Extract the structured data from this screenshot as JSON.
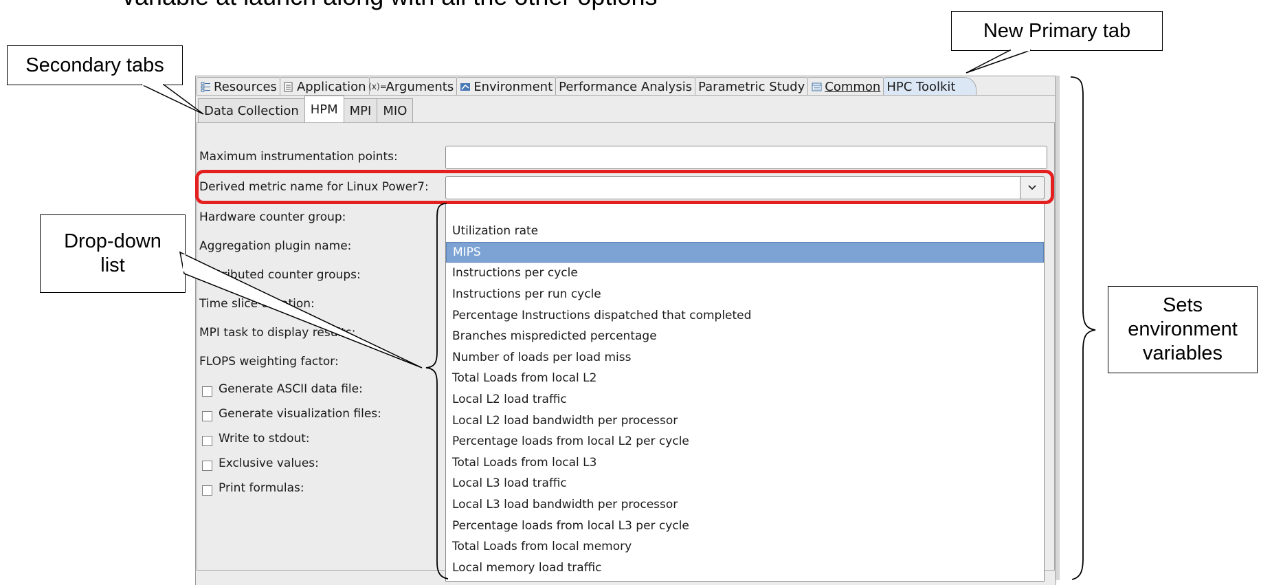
{
  "slide": {
    "heading_fragment": "variable at launch along with all the other options"
  },
  "callouts": {
    "secondary_tabs": "Secondary tabs",
    "new_primary_tab": "New Primary tab",
    "drop_down_line1": "Drop-down",
    "drop_down_line2": "list",
    "sets_line1": "Sets",
    "sets_line2": "environment",
    "sets_line3": "variables"
  },
  "primary_tabs": [
    {
      "label": "Resources",
      "icon": "resources-icon"
    },
    {
      "label": "Application",
      "icon": "document-icon"
    },
    {
      "label": "Arguments",
      "icon": "arguments-icon"
    },
    {
      "label": "Environment",
      "icon": "environment-icon"
    },
    {
      "label": "Performance Analysis",
      "icon": ""
    },
    {
      "label": "Parametric Study",
      "icon": ""
    },
    {
      "label": "Common",
      "icon": "common-icon"
    },
    {
      "label": "HPC Toolkit",
      "icon": "",
      "active": true
    }
  ],
  "secondary_tabs": [
    {
      "label": "Data Collection"
    },
    {
      "label": "HPM",
      "active": true
    },
    {
      "label": "MPI"
    },
    {
      "label": "MIO"
    }
  ],
  "form": {
    "max_points_label": "Maximum instrumentation points:",
    "max_points_value": "",
    "derived_metric_label": "Derived metric name for Linux Power7:",
    "derived_metric_value": "",
    "hw_counter_label": "Hardware counter group:",
    "aggregation_label": "Aggregation plugin name:",
    "distributed_label": "Distributed counter groups:",
    "time_slice_label": "Time slice duration:",
    "mpi_task_label": "MPI task to display results:",
    "flops_label": "FLOPS weighting factor:",
    "gen_ascii_label": "Generate ASCII data file:",
    "gen_vis_label": "Generate visualization files:",
    "write_stdout_label": "Write to stdout:",
    "exclusive_label": "Exclusive values:",
    "print_formulas_label": "Print formulas:"
  },
  "dropdown": {
    "items": [
      "Utilization rate",
      "MIPS",
      "Instructions per cycle",
      "Instructions per run cycle",
      "Percentage Instructions dispatched that completed",
      "Branches mispredicted percentage",
      "Number of loads per load miss",
      "Total Loads from local L2",
      "Local L2 load traffic",
      "Local L2 load bandwidth per processor",
      "Percentage loads from local L2 per cycle",
      "Total Loads from local L3",
      "Local L3 load traffic",
      "Local L3 load bandwidth per processor",
      "Percentage loads from local L3 per cycle",
      "Total Loads from local memory",
      "Local memory load traffic"
    ],
    "selected": "MIPS"
  },
  "colors": {
    "highlight": "#e41f1f",
    "selection": "#7ca3d4"
  }
}
